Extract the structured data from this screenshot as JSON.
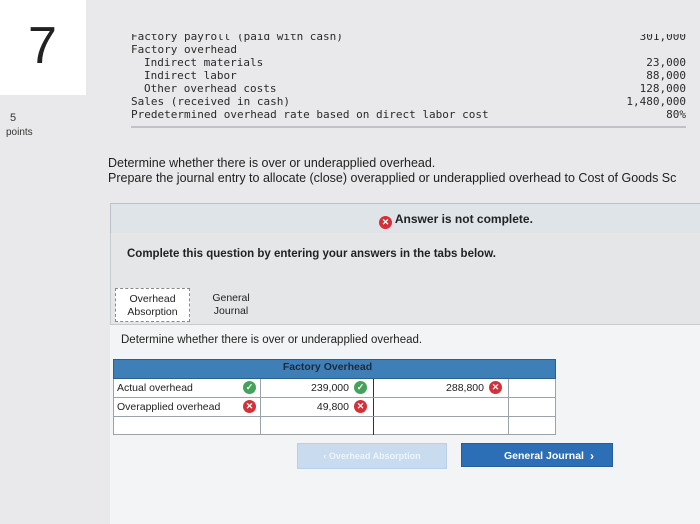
{
  "question": {
    "number": "7",
    "points_value": "5",
    "points_label": "points"
  },
  "cost_data": [
    {
      "label": "Factory payroll (paid with cash)",
      "value": "301,000",
      "indent": false,
      "cut": true
    },
    {
      "label": "Factory overhead",
      "value": "",
      "indent": false
    },
    {
      "label": "Indirect materials",
      "value": "23,000",
      "indent": true
    },
    {
      "label": "Indirect labor",
      "value": "88,000",
      "indent": true
    },
    {
      "label": "Other overhead costs",
      "value": "128,000",
      "indent": true
    },
    {
      "label": "Sales (received in cash)",
      "value": "1,480,000",
      "indent": false
    },
    {
      "label": "Predetermined overhead rate based on direct labor cost",
      "value": "80%",
      "indent": false
    }
  ],
  "instructions": {
    "line1": "Determine whether there is over or underapplied overhead.",
    "line2": "Prepare the journal entry to allocate (close) overapplied or underapplied overhead to Cost of Goods Sc"
  },
  "status": {
    "text": "Answer is not complete."
  },
  "panel": {
    "title": "Complete this question by entering your answers in the tabs below."
  },
  "tabs": [
    {
      "line1": "Overhead",
      "line2": "Absorption"
    },
    {
      "line1": "General",
      "line2": "Journal"
    }
  ],
  "prompt": "Determine whether there is over or underapplied overhead.",
  "ledger": {
    "title": "Factory Overhead",
    "rows": [
      {
        "account": "Actual overhead",
        "debit": "239,000",
        "credit": "288,800"
      },
      {
        "account": "Overapplied overhead",
        "debit": "49,800",
        "credit": ""
      },
      {
        "account": "",
        "debit": "",
        "credit": ""
      }
    ]
  },
  "nav": {
    "prev": "Overhead Absorption",
    "next": "General Journal"
  },
  "colors": {
    "header_blue": "#3f7fb8",
    "next_button": "#2d6fb6",
    "error": "#d3303a",
    "correct": "#44a35a"
  }
}
